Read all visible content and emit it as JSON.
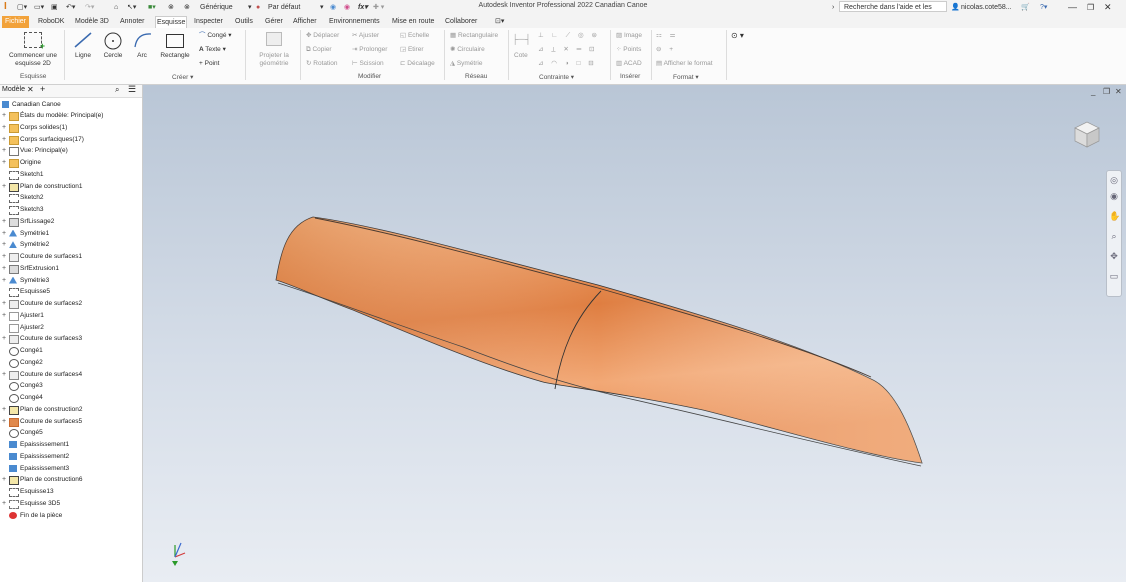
{
  "window": {
    "title": "Autodesk Inventor Professional 2022   Canadian Canoe",
    "search_placeholder": "Recherche dans l'aide et les com",
    "user": "nicolas.cote58...",
    "quick_access": {
      "material": "Générique",
      "appearance": "Par défaut"
    }
  },
  "tabs": [
    "Fichier",
    "RoboDK",
    "Modèle 3D",
    "Annoter",
    "Esquisse",
    "Inspecter",
    "Outils",
    "Gérer",
    "Afficher",
    "Environnements",
    "Mise en route",
    "Collaborer"
  ],
  "active_tab": "Esquisse",
  "ribbon": {
    "esquisse": {
      "label": "Esquisse",
      "start_btn": "Commencer une esquisse 2D"
    },
    "creer": {
      "label": "Créer",
      "ligne": "Ligne",
      "cercle": "Cercle",
      "arc": "Arc",
      "rectangle": "Rectangle",
      "conge": "Congé",
      "texte": "Texte",
      "point": "Point",
      "projeter": "Projeter la géométrie"
    },
    "modifier": {
      "label": "Modifier",
      "deplacer": "Déplacer",
      "copier": "Copier",
      "rotation": "Rotation",
      "ajuster": "Ajuster",
      "prolonger": "Prolonger",
      "scission": "Scission",
      "echelle": "Echelle",
      "etirer": "Etirer",
      "decalage": "Décalage"
    },
    "reseau": {
      "label": "Réseau",
      "rectangulaire": "Rectangulaire",
      "circulaire": "Circulaire",
      "symetrie": "Symétrie"
    },
    "contrainte": {
      "label": "Contrainte",
      "cote": "Cote"
    },
    "inserer": {
      "label": "Insérer",
      "image": "Image",
      "points": "Points",
      "acad": "ACAD"
    },
    "format": {
      "label": "Format",
      "afficher_format": "Afficher le format"
    }
  },
  "browser": {
    "tab_label": "Modèle",
    "root": "Canadian Canoe",
    "items": [
      {
        "label": "États du modèle: Principal(e)",
        "icon": "folder"
      },
      {
        "label": "Corps solides(1)",
        "icon": "folder"
      },
      {
        "label": "Corps surfaciques(17)",
        "icon": "folder"
      },
      {
        "label": "Vue: Principal(e)",
        "icon": "view"
      },
      {
        "label": "Origine",
        "icon": "folder"
      },
      {
        "label": "Sketch1",
        "icon": "sketch"
      },
      {
        "label": "Plan de construction1",
        "icon": "plane"
      },
      {
        "label": "Sketch2",
        "icon": "sketch"
      },
      {
        "label": "Sketch3",
        "icon": "sketch"
      },
      {
        "label": "SrfLissage2",
        "icon": "surface"
      },
      {
        "label": "Symétrie1",
        "icon": "mirror"
      },
      {
        "label": "Symétrie2",
        "icon": "mirror"
      },
      {
        "label": "Couture de surfaces1",
        "icon": "stitch"
      },
      {
        "label": "SrfExtrusion1",
        "icon": "surface"
      },
      {
        "label": "Symétrie3",
        "icon": "mirror"
      },
      {
        "label": "Esquisse5",
        "icon": "sketch"
      },
      {
        "label": "Couture de surfaces2",
        "icon": "stitch"
      },
      {
        "label": "Ajuster1",
        "icon": "trim"
      },
      {
        "label": "Ajuster2",
        "icon": "trim"
      },
      {
        "label": "Couture de surfaces3",
        "icon": "stitch"
      },
      {
        "label": "Congé1",
        "icon": "fillet"
      },
      {
        "label": "Congé2",
        "icon": "fillet"
      },
      {
        "label": "Couture de surfaces4",
        "icon": "stitch"
      },
      {
        "label": "Congé3",
        "icon": "fillet"
      },
      {
        "label": "Congé4",
        "icon": "fillet"
      },
      {
        "label": "Plan de construction2",
        "icon": "plane"
      },
      {
        "label": "Couture de surfaces5",
        "icon": "stitch-orange"
      },
      {
        "label": "Congé5",
        "icon": "fillet"
      },
      {
        "label": "Epaississement1",
        "icon": "thicken"
      },
      {
        "label": "Epaississement2",
        "icon": "thicken"
      },
      {
        "label": "Epaississement3",
        "icon": "thicken"
      },
      {
        "label": "Plan de construction6",
        "icon": "plane"
      },
      {
        "label": "Esquisse13",
        "icon": "sketch"
      },
      {
        "label": "Esquisse 3D5",
        "icon": "sketch3d"
      },
      {
        "label": "Fin de la pièce",
        "icon": "end"
      }
    ]
  },
  "colors": {
    "accent": "#f2a23a",
    "hull": "#e0894d",
    "viewport_top": "#b9c6d6",
    "viewport_bottom": "#e9edf3"
  }
}
